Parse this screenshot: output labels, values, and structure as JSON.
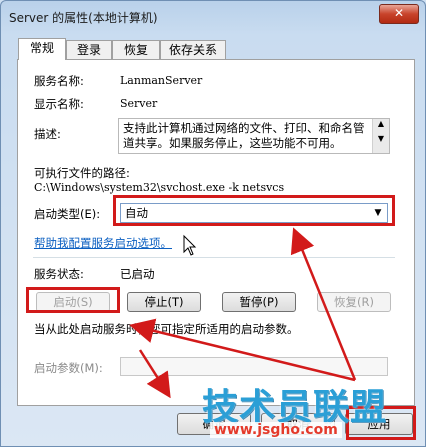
{
  "window": {
    "title": "Server 的属性(本地计算机)",
    "close_glyph": "✕"
  },
  "tabs": [
    {
      "label": "常规",
      "active": true
    },
    {
      "label": "登录",
      "active": false
    },
    {
      "label": "恢复",
      "active": false
    },
    {
      "label": "依存关系",
      "active": false
    }
  ],
  "general": {
    "service_name_label": "服务名称:",
    "service_name": "LanmanServer",
    "display_name_label": "显示名称:",
    "display_name": "Server",
    "description_label": "描述:",
    "description": "支持此计算机通过网络的文件、打印、和命名管道共享。如果服务停止，这些功能不可用。",
    "exe_path_label": "可执行文件的路径:",
    "exe_path": "C:\\Windows\\system32\\svchost.exe -k netsvcs",
    "startup_type_label": "启动类型(E):",
    "startup_type_value": "自动",
    "help_link": "帮助我配置服务启动选项。",
    "status_label": "服务状态:",
    "status_value": "已启动",
    "buttons": {
      "start": "启动(S)",
      "stop": "停止(T)",
      "pause": "暂停(P)",
      "resume": "恢复(R)"
    },
    "hint": "当从此处启动服务时，您可指定所适用的启动参数。",
    "param_label": "启动参数(M):",
    "param_value": ""
  },
  "dialog_buttons": {
    "ok": "确定",
    "cancel": "取消",
    "apply": "应用"
  },
  "watermark": {
    "text": "技术员联盟",
    "url": "www.jsgho.com"
  },
  "annotation_color": "#d21a1a"
}
